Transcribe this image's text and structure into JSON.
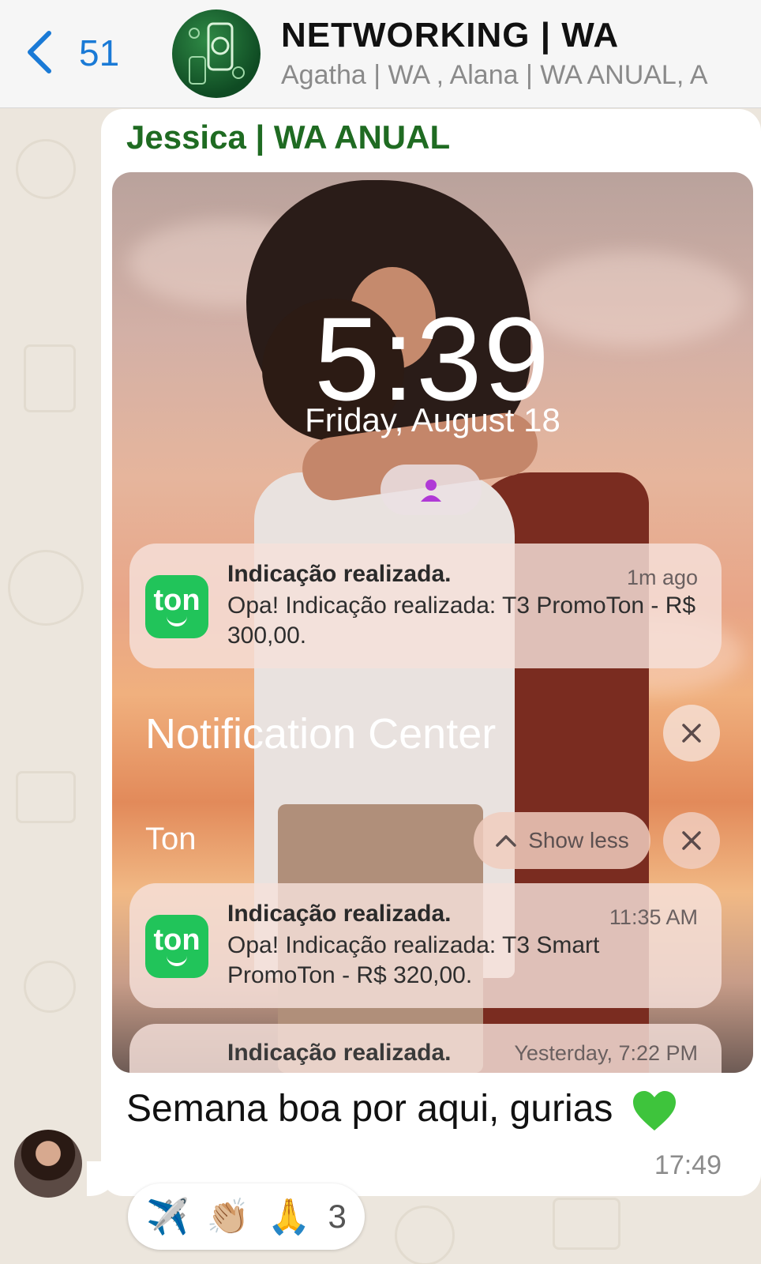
{
  "header": {
    "back_count": "51",
    "title": "NETWORKING | WA",
    "subtitle": "Agatha | WA , Alana | WA ANUAL, A"
  },
  "message": {
    "sender": "Jessica | WA ANUAL",
    "text": "Semana boa por aqui, gurias",
    "time": "17:49",
    "emoji": "heart-icon"
  },
  "screenshot": {
    "lock_time": "5:39",
    "lock_date": "Friday, August 18",
    "notification_center_title": "Notification Center",
    "group_label": "Ton",
    "show_less_label": "Show less",
    "notifications": [
      {
        "app": "ton",
        "title": "Indicação realizada.",
        "time": "1m ago",
        "body": "Opa! Indicação realizada: T3 PromoTon - R$ 300,00."
      },
      {
        "app": "ton",
        "title": "Indicação realizada.",
        "time": "11:35 AM",
        "body": "Opa! Indicação realizada: T3 Smart PromoTon - R$ 320,00."
      },
      {
        "app": "ton",
        "title": "Indicação realizada.",
        "time": "Yesterday, 7:22 PM",
        "body": ""
      }
    ]
  },
  "reactions": {
    "emojis": [
      "✈️",
      "👏🏼",
      "🙏"
    ],
    "count": "3"
  },
  "colors": {
    "accent_blue": "#1a7ad6",
    "sender_green": "#1f6b22",
    "ton_green": "#21c45a"
  }
}
